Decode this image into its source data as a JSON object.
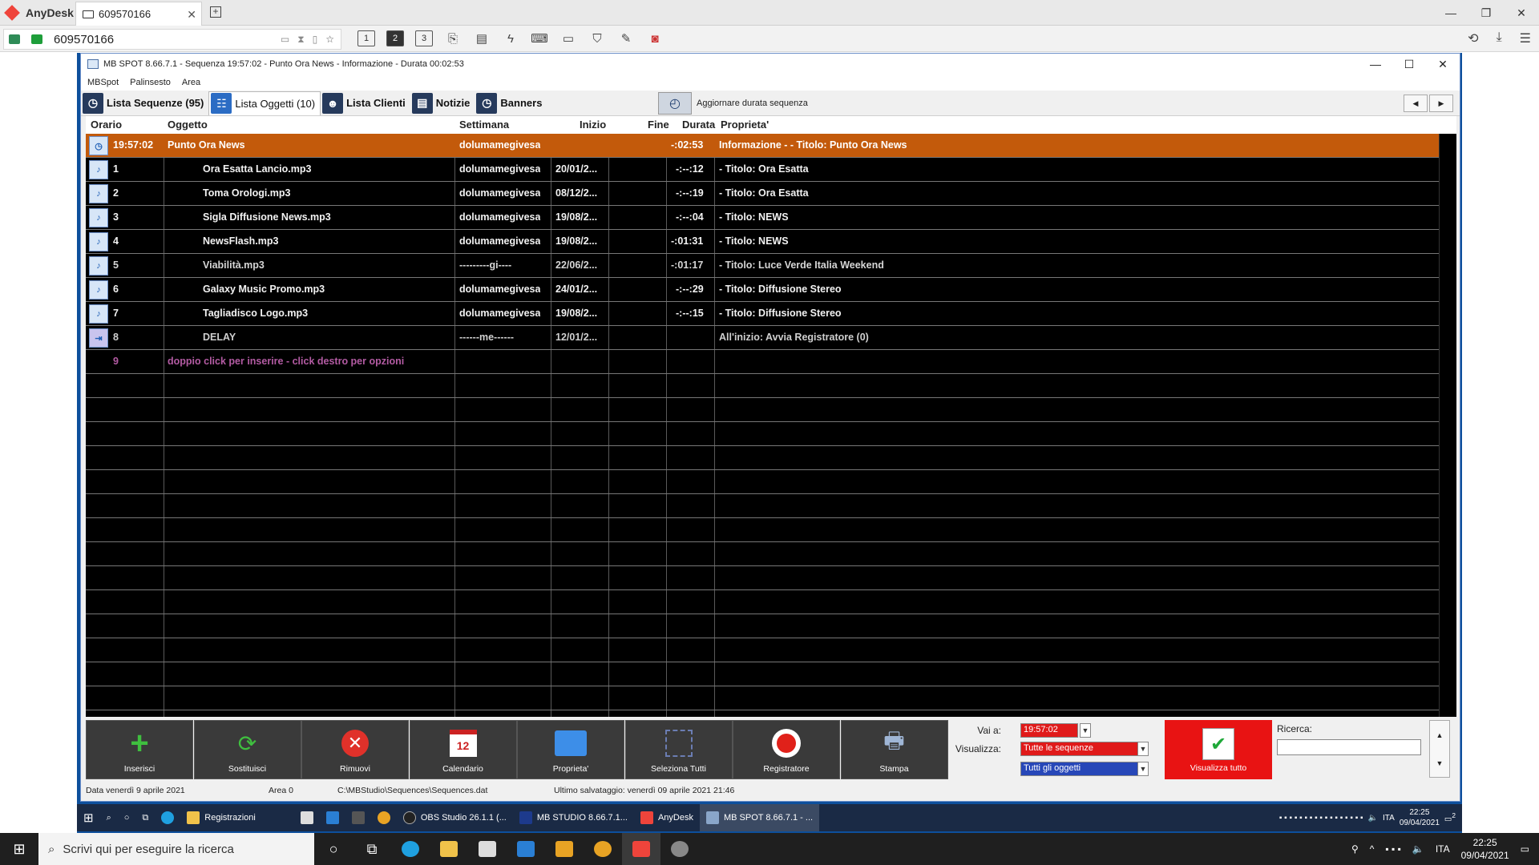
{
  "anydesk": {
    "brand": "AnyDesk",
    "tab_label": "609570166",
    "address": "609570166",
    "display_buttons": [
      "1",
      "2",
      "3"
    ],
    "active_display": "2"
  },
  "mbspot": {
    "window_title": "MB SPOT 8.66.7.1 - Sequenza 19:57:02 - Punto Ora News - Informazione - Durata 00:02:53",
    "menu": [
      "MBSpot",
      "Palinsesto",
      "Area"
    ],
    "tabs": [
      {
        "label": "Lista Sequenze (95)",
        "icon": "clock-icon"
      },
      {
        "label": "Lista Oggetti (10)",
        "icon": "list-icon"
      },
      {
        "label": "Lista Clienti",
        "icon": "user-icon"
      },
      {
        "label": "Notizie",
        "icon": "news-icon"
      },
      {
        "label": "Banners",
        "icon": "clock-icon"
      }
    ],
    "update_duration_label": "Aggiornare durata sequenza",
    "columns": [
      "Orario",
      "Oggetto",
      "Settimana",
      "Inizio",
      "Fine",
      "Durata",
      "Proprieta'"
    ],
    "rows": [
      {
        "orario": "19:57:02",
        "oggetto": "Punto Ora News",
        "settimana": "dolumamegivesa",
        "inizio": "",
        "fine": "",
        "durata": "-:02:53",
        "proprieta": "Informazione -  - Titolo: Punto Ora News"
      },
      {
        "orario": "1",
        "oggetto": "Ora Esatta Lancio.mp3",
        "settimana": "dolumamegivesa",
        "inizio": "20/01/2...",
        "fine": "",
        "durata": "-:--:12",
        "proprieta": " - Titolo: Ora Esatta"
      },
      {
        "orario": "2",
        "oggetto": "Toma Orologi.mp3",
        "settimana": "dolumamegivesa",
        "inizio": "08/12/2...",
        "fine": "",
        "durata": "-:--:19",
        "proprieta": " - Titolo: Ora Esatta"
      },
      {
        "orario": "3",
        "oggetto": "Sigla Diffusione News.mp3",
        "settimana": "dolumamegivesa",
        "inizio": "19/08/2...",
        "fine": "",
        "durata": "-:--:04",
        "proprieta": " - Titolo: NEWS"
      },
      {
        "orario": "4",
        "oggetto": "NewsFlash.mp3",
        "settimana": "dolumamegivesa",
        "inizio": "19/08/2...",
        "fine": "",
        "durata": "-:01:31",
        "proprieta": " - Titolo: NEWS"
      },
      {
        "orario": "5",
        "oggetto": "Viabilità.mp3",
        "settimana": "---------gi----",
        "inizio": "22/06/2...",
        "fine": "",
        "durata": "-:01:17",
        "proprieta": " - Titolo: Luce Verde Italia Weekend"
      },
      {
        "orario": "6",
        "oggetto": "Galaxy Music Promo.mp3",
        "settimana": "dolumamegivesa",
        "inizio": "24/01/2...",
        "fine": "",
        "durata": "-:--:29",
        "proprieta": " - Titolo: Diffusione Stereo"
      },
      {
        "orario": "7",
        "oggetto": "Tagliadisco Logo.mp3",
        "settimana": "dolumamegivesa",
        "inizio": "19/08/2...",
        "fine": "",
        "durata": "-:--:15",
        "proprieta": " - Titolo: Diffusione Stereo"
      },
      {
        "orario": "8",
        "oggetto": "DELAY",
        "settimana": "------me------",
        "inizio": "12/01/2...",
        "fine": "",
        "durata": "",
        "proprieta": "All'inizio: Avvia Registratore (0)"
      }
    ],
    "hint_row": {
      "num": "9",
      "text": "doppio click per inserire - click destro per opzioni"
    },
    "buttons": [
      "Inserisci",
      "Sostituisci",
      "Rimuovi",
      "Calendario",
      "Proprieta'",
      "Seleziona Tutti",
      "Registratore",
      "Stampa"
    ],
    "goto_label": "Vai a:",
    "goto_value": "19:57:02",
    "view_label": "Visualizza:",
    "view_sequences": "Tutte le sequenze",
    "view_objects": "Tutti gli oggetti",
    "show_all_label": "Visualizza tutto",
    "search_label": "Ricerca:",
    "status": {
      "date": "Data venerdì 9 aprile 2021",
      "area": "Area 0",
      "path": "C:\\MBStudio\\Sequences\\Sequences.dat",
      "saved": "Ultimo salvataggio: venerdì 09 aprile 2021 21:46"
    }
  },
  "remote_taskbar": {
    "items": [
      "Registrazioni",
      "OBS Studio 26.1.1 (...",
      "MB STUDIO 8.66.7.1...",
      "AnyDesk",
      "MB SPOT 8.66.7.1 - ..."
    ],
    "lang": "ITA",
    "time": "22:25",
    "date": "09/04/2021",
    "notif_count": "2"
  },
  "local_taskbar": {
    "search_placeholder": "Scrivi qui per eseguire la ricerca",
    "lang": "ITA",
    "time": "22:25",
    "date": "09/04/2021"
  },
  "colors": {
    "highlight_row": "#c35a0b",
    "grid_bg": "#000000",
    "hint_text": "#b35ba3",
    "visualizza_tutto": "#e81313",
    "anydesk_red": "#ef443b"
  }
}
